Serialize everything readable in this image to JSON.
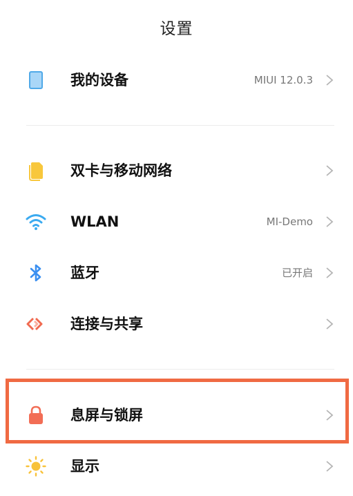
{
  "header": {
    "title": "设置"
  },
  "sections": {
    "device": {
      "label": "我的设备",
      "value": "MIUI 12.0.3",
      "icon": "tablet-icon"
    },
    "sim": {
      "label": "双卡与移动网络",
      "value": "",
      "icon": "sim-card-icon"
    },
    "wlan": {
      "label": "WLAN",
      "value": "MI-Demo",
      "icon": "wifi-icon"
    },
    "bluetooth": {
      "label": "蓝牙",
      "value": "已开启",
      "icon": "bluetooth-icon"
    },
    "share": {
      "label": "连接与共享",
      "value": "",
      "icon": "connection-share-icon"
    },
    "lock": {
      "label": "息屏与锁屏",
      "value": "",
      "icon": "lock-icon"
    },
    "display": {
      "label": "显示",
      "value": "",
      "icon": "sun-icon"
    }
  },
  "colors": {
    "highlight": "#f06a43",
    "device_icon": "#4fa9e8",
    "sim_icon": "#f8c73c",
    "wifi_icon": "#3aaaf0",
    "bluetooth_icon": "#3b8ff0",
    "share_icon": "#f06a50",
    "lock_icon": "#f26d55",
    "sun_icon": "#f8c23a"
  }
}
